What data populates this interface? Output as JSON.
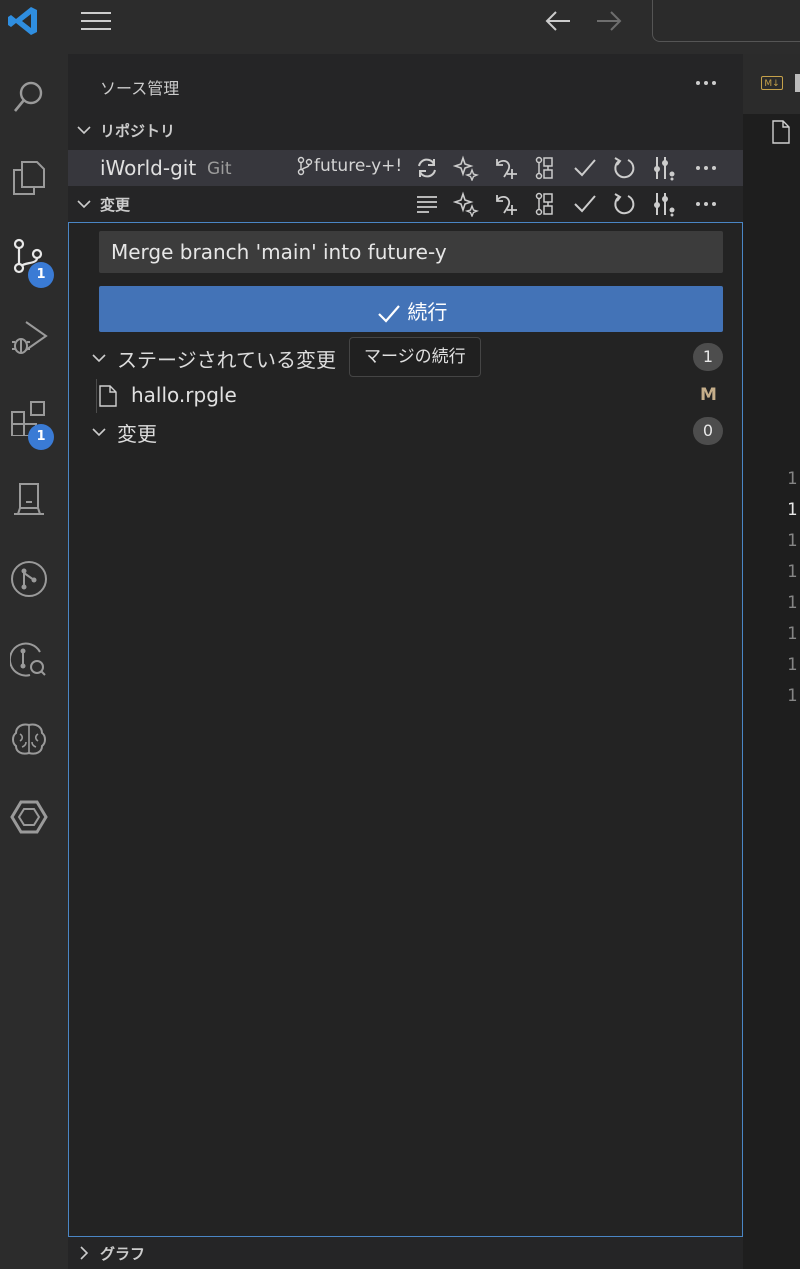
{
  "colors": {
    "accent": "#4373b7",
    "badge": "#3a7bd5",
    "modified": "#c5ae8a",
    "focus_border": "#4a86c5"
  },
  "titlebar": {
    "icons": [
      "vscode-logo-icon",
      "hamburger-menu-icon",
      "arrow-left-icon",
      "arrow-right-icon"
    ]
  },
  "activity_bar": [
    {
      "name": "search-icon"
    },
    {
      "name": "explorer-icon"
    },
    {
      "name": "source-control-icon",
      "badge": "1"
    },
    {
      "name": "run-debug-icon"
    },
    {
      "name": "extensions-icon",
      "badge": "1"
    },
    {
      "name": "remote-explorer-icon"
    },
    {
      "name": "git-graph-icon"
    },
    {
      "name": "git-history-icon"
    },
    {
      "name": "brain-icon"
    },
    {
      "name": "hexagon-icon"
    }
  ],
  "sidebar": {
    "title": "ソース管理",
    "repositories": {
      "label": "リポジトリ",
      "repo_name": "iWorld-git",
      "repo_kind": "Git",
      "branch": "future-y+!"
    },
    "changes_section": {
      "label": "変更",
      "commit_message": "Merge branch 'main' into future-y",
      "commit_button_label": "続行",
      "tooltip": "マージの続行",
      "staged_group": {
        "label": "ステージされている変更",
        "count": "1"
      },
      "files": [
        {
          "name": "hallo.rpgle",
          "status": "M"
        }
      ],
      "changes_group": {
        "label": "変更",
        "count": "0"
      }
    },
    "graph": {
      "label": "グラフ"
    }
  },
  "editor": {
    "tab_badge": "M↓",
    "line_numbers": [
      "1",
      "1",
      "1",
      "1",
      "1",
      "1",
      "1",
      "1"
    ]
  }
}
